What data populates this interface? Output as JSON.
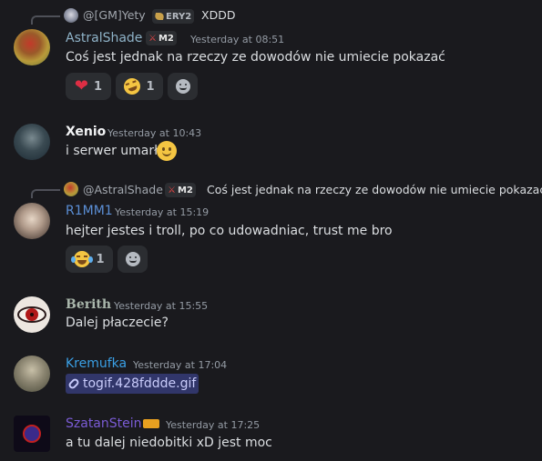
{
  "messages": [
    {
      "author": "AstralShade",
      "author_color": "#8fb3c8",
      "badge": "M2",
      "timestamp": "Yesterday at 08:51",
      "reply": {
        "author": "@[GM]Yety",
        "badge": "ERY2",
        "text": "XDDD"
      },
      "content": "Coś jest jednak na rzeczy ze dowodów nie umiecie pokazać",
      "reactions": [
        {
          "icon": "heart",
          "count": "1"
        },
        {
          "icon": "laughing",
          "count": "1"
        }
      ]
    },
    {
      "author": "Xenio",
      "author_color": "#f2f3f5",
      "timestamp": "Yesterday at 10:43",
      "content": "i serwer umarł"
    },
    {
      "author": "R1MM1",
      "author_color": "#5b8fd6",
      "timestamp": "Yesterday at 15:19",
      "reply": {
        "author": "@AstralShade",
        "badge": "M2",
        "text": "Coś jest jednak na rzeczy ze dowodów nie umiecie pokazać"
      },
      "content": "hejter jestes i troll, po co udowadniac, trust me bro",
      "reactions": [
        {
          "icon": "tears-of-joy",
          "count": "1"
        }
      ]
    },
    {
      "author": "Berith",
      "author_color": "#a9b6ab",
      "timestamp": "Yesterday at 15:55",
      "content": "Dalej płaczecie?"
    },
    {
      "author": "Kremufka",
      "author_color": "#3aa0e6",
      "timestamp": "Yesterday at 17:04",
      "attachment": "togif.428fddde.gif"
    },
    {
      "author": "SzatanStein",
      "author_color": "#7b5cd6",
      "timestamp": "Yesterday at 17:25",
      "content": "a tu dalej niedobitki xD jest moc"
    }
  ]
}
